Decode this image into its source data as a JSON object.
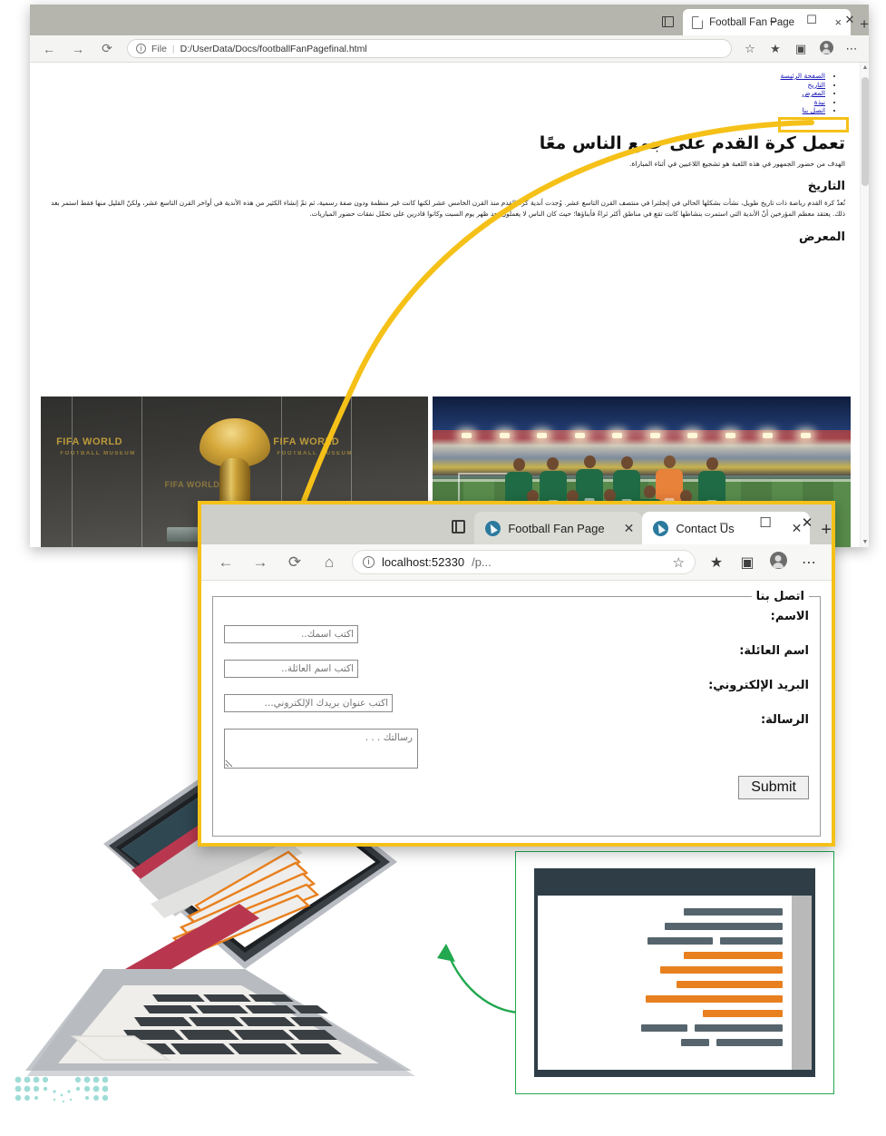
{
  "window_back": {
    "tab": {
      "title": "Football Fan Page",
      "close_label": "×",
      "favicon": "document-icon"
    },
    "new_tab_label": "+",
    "controls": {
      "minimize": "–",
      "maximize": "☐",
      "close": "✕"
    },
    "nav": {
      "back": "←",
      "forward": "→",
      "reload": "⟳"
    },
    "omnibox": {
      "info_icon": "i",
      "scheme_label": "File",
      "separator": "|",
      "url": "D:/UserData/Docs/footballFanPagefinal.html"
    },
    "toolbar_icons": [
      "favorite-add-icon",
      "collections-icon",
      "browser-essentials-icon",
      "profile-avatar-icon",
      "settings-more-icon"
    ],
    "page": {
      "nav_links": [
        "الصفحة الرئيسة",
        "التاريخ",
        "المعرض",
        "نبذة",
        "اتصل بنا"
      ],
      "heading": "تعمل كرة القدم على جمع الناس معًا",
      "intro": "الهدف من حضور الجمهور في هذه اللعبة هو تشجيع اللاعبين في أثناء المباراة.",
      "history_heading": "التاريخ",
      "history_text": "تُعدّ كرة القدم رياضة ذات تاريخ طويل، نشأت بشكلها الحالي في إنجلترا في منتصف القرن التاسع عشر. وُجدت أندية كرة القدم منذ القرن الخامس عشر لكنها كانت غير منظمة ودون صفة رسمية، ثم تمّ إنشاء الكثير من هذه الأندية في أواخر القرن التاسع عشر، ولكنّ القليل منها فقط استمر بعد ذلك. يعتقد معظم المؤرخين أنّ الأندية التي استمرت بنشاطها كانت تقع في مناطق أكثر ثراءً فأبناؤها؛ حيث كان الناس لا يعملون بعد ظهر يوم السبت وكانوا قادرين على تحمّل نفقات حضور المباريات.",
      "gallery_heading": "المعرض",
      "gallery": [
        {
          "alt": "صورة المنتخب السعودي في الملعب"
        },
        {
          "alt": "كأس العالم في متحف فيفا",
          "museum_text": "FIFA WORLD",
          "museum_sub": "FOOTBALL MUSEUM"
        }
      ]
    }
  },
  "window_front": {
    "tabs": [
      {
        "title": "Football Fan Page",
        "active": false,
        "close_label": "✕",
        "favicon": "edge-icon"
      },
      {
        "title": "Contact Us",
        "active": true,
        "close_label": "✕",
        "favicon": "edge-icon"
      }
    ],
    "new_tab_label": "+",
    "controls": {
      "minimize": "–",
      "maximize": "☐",
      "close": "✕"
    },
    "nav": {
      "back": "←",
      "forward": "→",
      "reload": "⟳",
      "home": "⌂"
    },
    "omnibox": {
      "info_icon": "i",
      "url_host": "localhost:52330",
      "url_path": "/p..."
    },
    "toolbar_icons": [
      "favorite-add-icon",
      "collections-icon",
      "browser-essentials-icon",
      "profile-avatar-icon",
      "settings-more-icon"
    ],
    "form": {
      "legend": "اتصل بنا",
      "fields": [
        {
          "label": "الاسم:",
          "placeholder": "اكتب اسمك..",
          "value": "",
          "type": "text",
          "name": "first-name"
        },
        {
          "label": "اسم العائلة:",
          "placeholder": "اكتب اسم العائلة..",
          "value": "",
          "type": "text",
          "name": "last-name"
        },
        {
          "label": "البريد الإلكتروني:",
          "placeholder": "اكتب عنوان بريدك الإلكتروني...",
          "value": "",
          "type": "email",
          "name": "email"
        },
        {
          "label": "الرسالة:",
          "placeholder": "رسالتك . . .",
          "value": "",
          "type": "textarea",
          "name": "message"
        }
      ],
      "submit_label": "Submit"
    }
  },
  "illustration": {
    "laptop": {
      "name": "laptop-mockup",
      "screen_accent": "#b8374f",
      "screen_header": "#2f4751",
      "field_outline": "#e8801f",
      "field_count": 5
    },
    "code_panel": {
      "name": "code-editor-mockup",
      "border_color": "#22a84f",
      "header_color": "#2f3e46",
      "code_color": "#56656d",
      "highlight_color": "#e8801f",
      "highlight_lines": 5
    },
    "callout_color": "#f5c118",
    "arrow_color": "#22a84f",
    "logo": {
      "name": "saudi-moe-logo",
      "color": "#9fdcd6"
    }
  }
}
